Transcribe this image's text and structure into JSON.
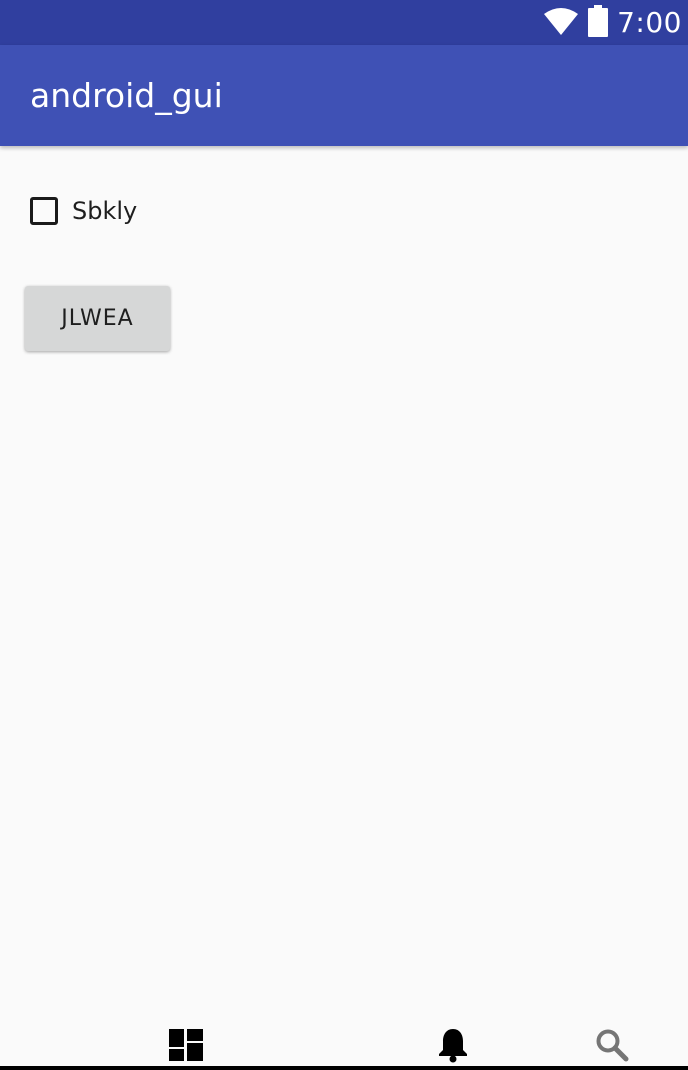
{
  "status_bar": {
    "time": "7:00",
    "icons": [
      "wifi-icon",
      "battery-icon"
    ],
    "background": "#303f9f"
  },
  "app_bar": {
    "title": "android_gui",
    "background": "#3f51b5"
  },
  "content": {
    "checkbox": {
      "label": "Sbkly",
      "checked": false
    },
    "button": {
      "label": "JLWEA"
    }
  },
  "bottom_nav": {
    "items": [
      {
        "icon": "dashboard-icon",
        "color": "#000000"
      },
      {
        "icon": "bell-icon",
        "color": "#000000"
      },
      {
        "icon": "search-icon",
        "color": "#757575"
      }
    ]
  }
}
